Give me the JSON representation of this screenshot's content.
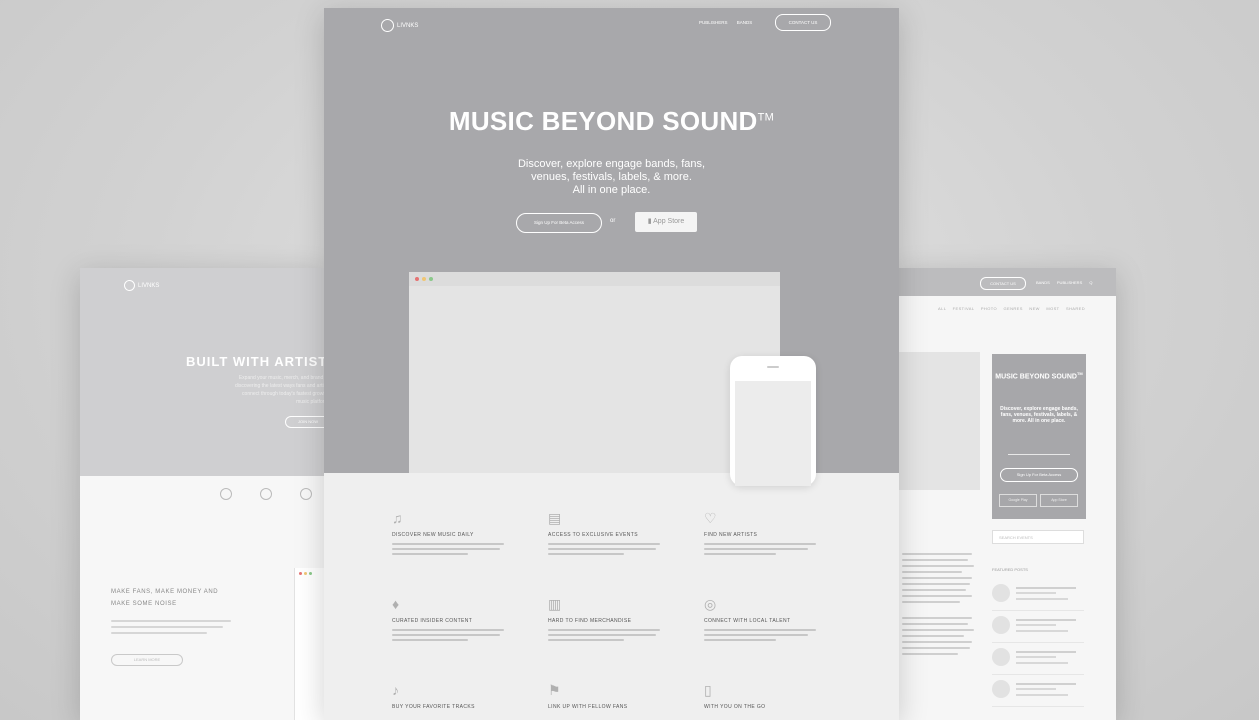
{
  "left_mockup": {
    "logo_text": "LIVNKS",
    "title": "BUILT WITH ARTISTS",
    "subtitle": "Expand your music, merch, and brand by discovering the latest ways fans and artists connect through today's fastest growing music platform.",
    "cta_label": "JOIN NOW",
    "section_heading": "MAKE FANS, MAKE MONEY AND MAKE SOME NOISE",
    "learn_more_label": "LEARN MORE",
    "feature_icons": [
      "pin-icon",
      "check-icon",
      "people-icon"
    ]
  },
  "center_mockup": {
    "logo_text": "LIVNKS",
    "nav": {
      "publishers": "PUBLISHERS",
      "bands": "BANDS",
      "cta": "CONTACT US"
    },
    "hero_title": "MUSIC BEYOND SOUND",
    "trademark": "TM",
    "hero_subtitle_lines": [
      "Discover,  explore engage  bands, fans,",
      "venues, festivals, labels, & more.",
      "All in one place."
    ],
    "signup_label": "Sign Up For Beta Access",
    "or_text": "or",
    "app_store_label": "App Store",
    "features": [
      {
        "icon": "music-note-icon",
        "glyph": "♫",
        "title": "DISCOVER NEW MUSIC DAILY"
      },
      {
        "icon": "ticket-icon",
        "glyph": "▤",
        "title": "ACCESS TO EXCLUSIVE EVENTS"
      },
      {
        "icon": "heart-icon",
        "glyph": "♡",
        "title": "FIND NEW ARTISTS"
      },
      {
        "icon": "microphone-icon",
        "glyph": "♦",
        "title": "CURATED INSIDER CONTENT"
      },
      {
        "icon": "shirt-icon",
        "glyph": "▥",
        "title": "HARD TO FIND MERCHANDISE"
      },
      {
        "icon": "location-pin-icon",
        "glyph": "◎",
        "title": "CONNECT WITH LOCAL TALENT"
      },
      {
        "icon": "headphones-icon",
        "glyph": "♪",
        "title": "BUY YOUR FAVORITE TRACKS"
      },
      {
        "icon": "flag-icon",
        "glyph": "⚑",
        "title": "LINK UP WITH FELLOW FANS"
      },
      {
        "icon": "phone-icon",
        "glyph": "▯",
        "title": "WITH YOU ON THE GO"
      }
    ]
  },
  "right_mockup": {
    "top_button": "CONTACT US",
    "top_links": "BANDS  PUBLISHERS  Q",
    "subnav": "ALL  FESTIVAL  PHOTO  GENRES  NEW  MOST SHARED",
    "card_title": "MUSIC BEYOND SOUND",
    "card_trademark": "TM",
    "card_subtitle": "Discover, explore engage bands, fans, venues, festivals, labels, & more. All in one place.",
    "card_cta": "Sign Up For Beta Access",
    "card_btn_1": "Google Play",
    "card_btn_2": "App Store",
    "search_placeholder": "SEARCH EVENTS",
    "recent_heading": "FEATURED POSTS",
    "recent_count": 4
  },
  "colors": {
    "background": "#d0d0d0",
    "hero_gray": "#a8a8ab",
    "light_hero_gray": "#cfcfd1",
    "dot_red": "#e57373",
    "dot_yellow": "#f0c674",
    "dot_green": "#8bc98b"
  }
}
